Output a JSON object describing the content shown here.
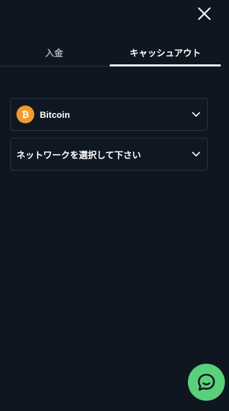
{
  "header": {
    "close_icon": "close-icon"
  },
  "tabs": {
    "deposit_label": "入金",
    "cashout_label": "キャッシュアウト",
    "active": "cashout"
  },
  "currency_select": {
    "selected_value": "Bitcoin",
    "icon": "bitcoin-icon",
    "dropdown_icon": "chevron-down-icon"
  },
  "network_select": {
    "placeholder": "ネットワークを選択して下さい",
    "dropdown_icon": "chevron-down-icon"
  },
  "chat": {
    "icon": "chat-bubble-icon"
  },
  "colors": {
    "background": "#0e1620",
    "bitcoin_orange": "#f39a2a",
    "chat_green": "#5ad07a",
    "border": "#2b3540"
  }
}
